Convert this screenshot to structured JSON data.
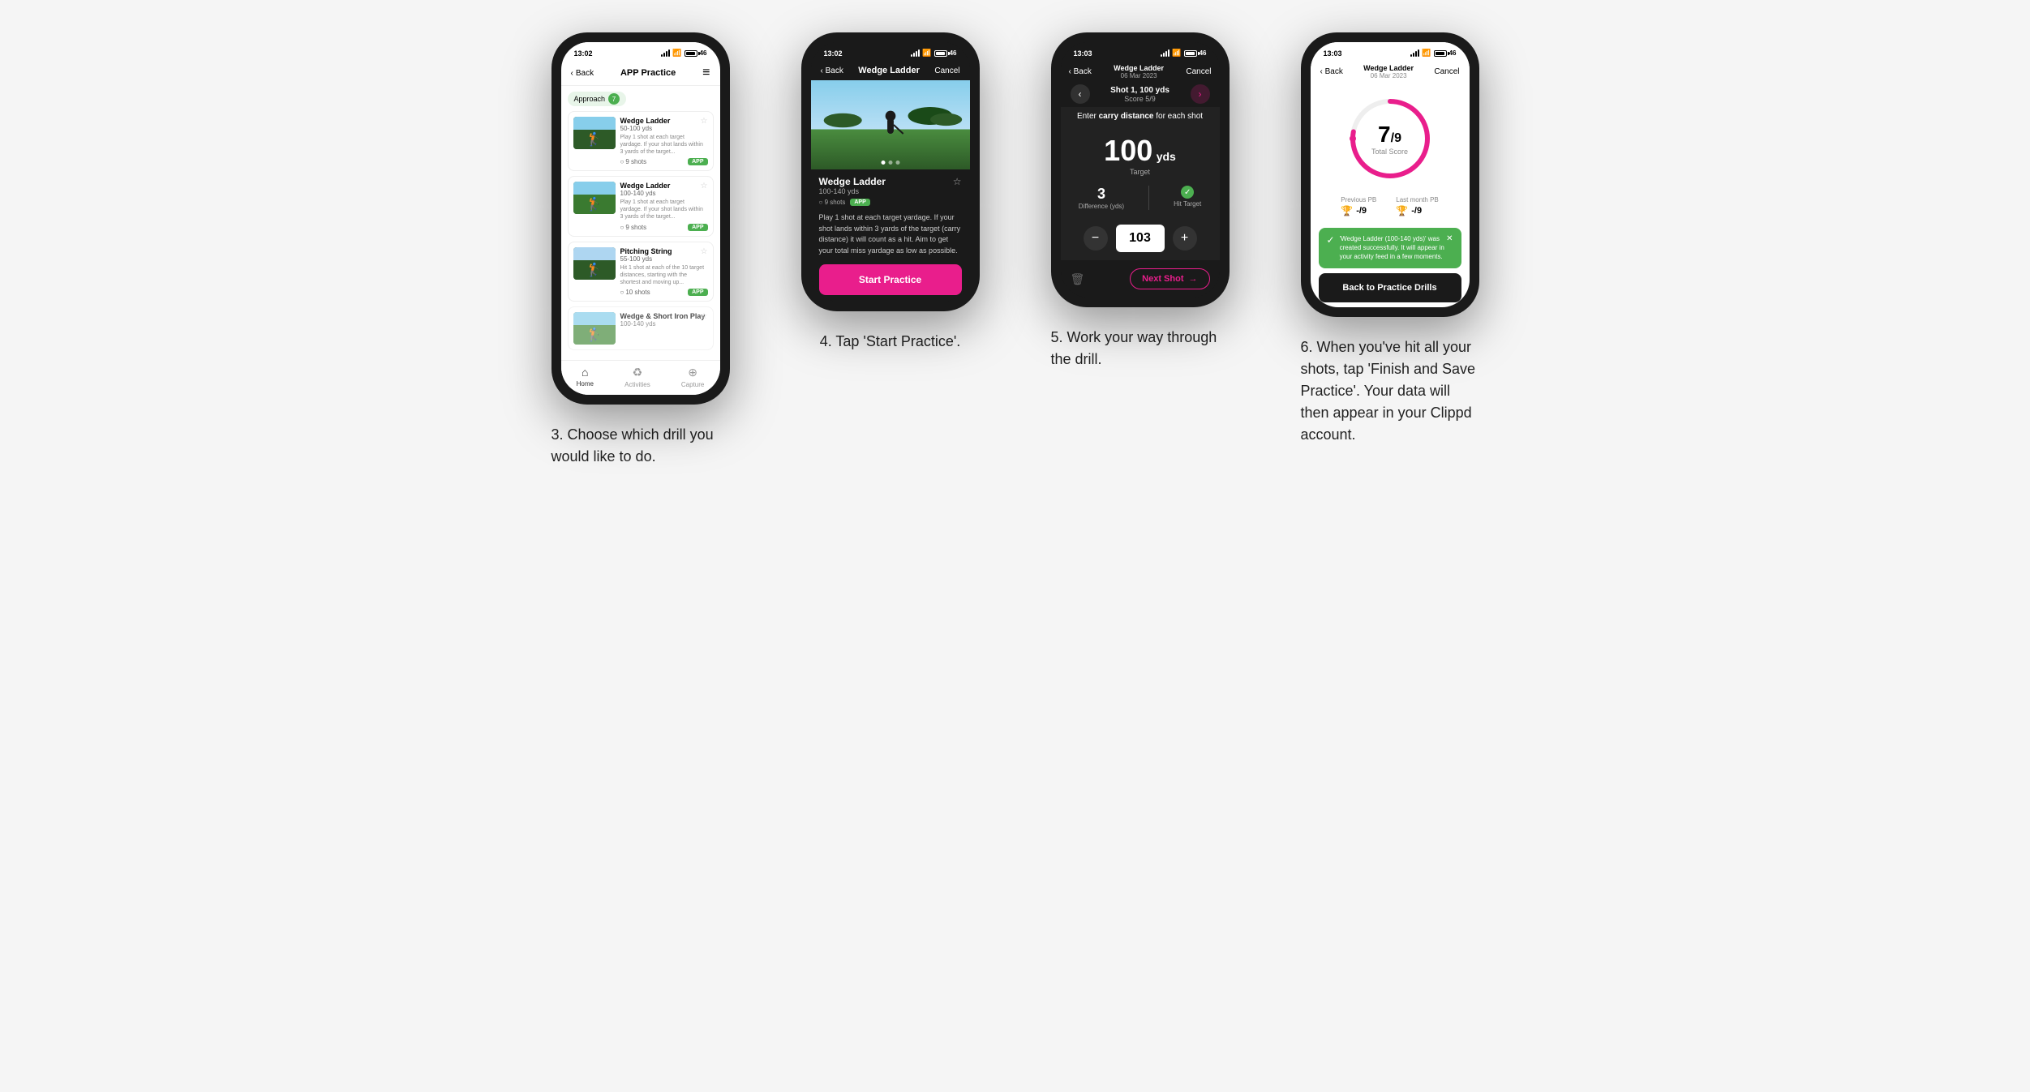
{
  "page": {
    "background": "#f5f5f5"
  },
  "phones": [
    {
      "id": "phone3",
      "step": "3",
      "caption": "3. Choose which drill you would like to do.",
      "statusBar": {
        "time": "13:02",
        "signal": true,
        "wifi": true,
        "battery": "46"
      },
      "nav": {
        "back": "Back",
        "title": "APP Practice",
        "menuIcon": "≡"
      },
      "category": {
        "label": "Approach",
        "count": "7"
      },
      "drills": [
        {
          "name": "Wedge Ladder",
          "yards": "50-100 yds",
          "desc": "Play 1 shot at each target yardage. If your shot lands within 3 yards of the target...",
          "shots": "9 shots",
          "badge": "APP"
        },
        {
          "name": "Wedge Ladder",
          "yards": "100-140 yds",
          "desc": "Play 1 shot at each target yardage. If your shot lands within 3 yards of the target...",
          "shots": "9 shots",
          "badge": "APP"
        },
        {
          "name": "Pitching String",
          "yards": "55-100 yds",
          "desc": "Hit 1 shot at each of the 10 target distances, starting with the shortest and moving up...",
          "shots": "10 shots",
          "badge": "APP"
        },
        {
          "name": "Wedge & Short Iron Play",
          "yards": "100-140 yds",
          "desc": "",
          "shots": "",
          "badge": ""
        }
      ],
      "bottomNav": [
        {
          "label": "Home",
          "icon": "⌂",
          "active": true
        },
        {
          "label": "Activities",
          "icon": "♻",
          "active": false
        },
        {
          "label": "Capture",
          "icon": "⊕",
          "active": false
        }
      ]
    },
    {
      "id": "phone4",
      "step": "4",
      "caption": "4. Tap 'Start Practice'.",
      "statusBar": {
        "time": "13:02",
        "signal": true,
        "wifi": true,
        "battery": "46"
      },
      "nav": {
        "back": "Back",
        "title": "Wedge Ladder",
        "cancel": "Cancel"
      },
      "drill": {
        "name": "Wedge Ladder",
        "yards": "100-140 yds",
        "shots": "9 shots",
        "badge": "APP",
        "desc": "Play 1 shot at each target yardage. If your shot lands within 3 yards of the target (carry distance) it will count as a hit. Aim to get your total miss yardage as low as possible."
      },
      "startButton": "Start Practice",
      "imageDots": [
        "active",
        "",
        ""
      ]
    },
    {
      "id": "phone5",
      "step": "5",
      "caption": "5. Work your way through the drill.",
      "statusBar": {
        "time": "13:03",
        "signal": true,
        "wifi": true,
        "battery": "46"
      },
      "nav": {
        "back": "Back",
        "drillTitle": "Wedge Ladder",
        "drillSub": "06 Mar 2023",
        "cancel": "Cancel"
      },
      "shot": {
        "label": "Shot 1, 100 yds",
        "score": "Score 5/9"
      },
      "carryPrompt": "Enter carry distance for each shot",
      "carryPromptBold": "carry distance",
      "target": {
        "value": "100",
        "unit": "yds",
        "label": "Target"
      },
      "stats": {
        "difference": "3",
        "differenceLabel": "Difference (yds)",
        "hitTarget": "Hit Target",
        "hitTargetIcon": "✓"
      },
      "inputValue": "103",
      "buttons": {
        "minus": "−",
        "plus": "+"
      },
      "nextShot": "Next Shot"
    },
    {
      "id": "phone6",
      "step": "6",
      "caption": "6. When you've hit all your shots, tap 'Finish and Save Practice'. Your data will then appear in your Clippd account.",
      "statusBar": {
        "time": "13:03",
        "signal": true,
        "wifi": true,
        "battery": "46"
      },
      "nav": {
        "back": "Back",
        "drillTitle": "Wedge Ladder",
        "drillSub": "06 Mar 2023",
        "cancel": "Cancel"
      },
      "score": {
        "value": "7",
        "total": "9",
        "label": "Total Score"
      },
      "pbs": {
        "previous": {
          "label": "Previous PB",
          "value": "-/9"
        },
        "lastMonth": {
          "label": "Last month PB",
          "value": "-/9"
        }
      },
      "toast": {
        "message": "'Wedge Ladder (100-140 yds)' was created successfully. It will appear in your activity feed in a few moments."
      },
      "backButton": "Back to Practice Drills"
    }
  ]
}
